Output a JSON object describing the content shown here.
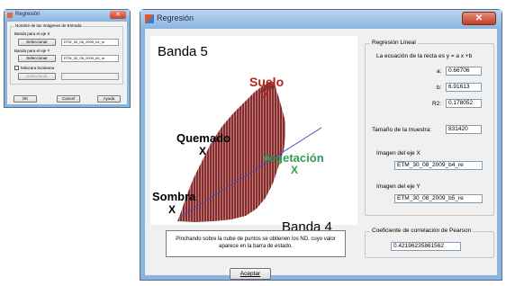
{
  "small_dialog": {
    "title": "Regresión",
    "close_label": "✕",
    "group_label": "Nombre de las Imágenes de Entrada",
    "x_label": "Banda para el eje X",
    "x_button": "Seleccionar",
    "x_value": "ETM_30_08_2009_b4_re",
    "y_label": "Banda para el eje Y",
    "y_button": "Seleccionar",
    "y_value": "ETM_30_08_2009_b5_re",
    "mask_label": "Máscara booleana",
    "mask_button": "Seleccionar",
    "ok": "OK",
    "cancel": "Cancel",
    "help": "Ayuda"
  },
  "main_dialog": {
    "title": "Regresión",
    "close_label": "✕",
    "plot": {
      "y_band": "Banda 5",
      "x_band": "Banda 4",
      "annotations": {
        "suelo": "Suelo",
        "quemado": "Quemado",
        "vegetacion": "Vegetación",
        "sombra": "Sombra",
        "marker": "X"
      }
    },
    "hint": "Pinchando sobre la nube de puntos se obtienen los ND, cuyo valor aparece en la barra de estado.",
    "accept": "Aceptar",
    "regression": {
      "group_label": "Regresión Lineal",
      "equation": "La ecuación de la recta es y = a x +b",
      "a_label": "a:",
      "a_value": "0.66706",
      "b_label": "b:",
      "b_value": "6.91613",
      "r2_label": "R2:",
      "r2_value": "0.178052",
      "sample_label": "Tamaño de la muestra:",
      "sample_value": "831420",
      "x_image_label": "Imagen del eje X",
      "x_image_value": "ETM_30_08_2009_b4_re",
      "y_image_label": "Imagen del eje Y",
      "y_image_value": "ETM_30_08_2009_b5_re"
    },
    "pearson": {
      "group_label": "Coeficiente de correlación de Pearson",
      "value": "0.42196235861562"
    }
  },
  "colors": {
    "scatter": "#8a2b2b",
    "regression_line": "#3d4fb8",
    "suelo": "#b0231e",
    "vegetacion": "#2e9d55"
  }
}
